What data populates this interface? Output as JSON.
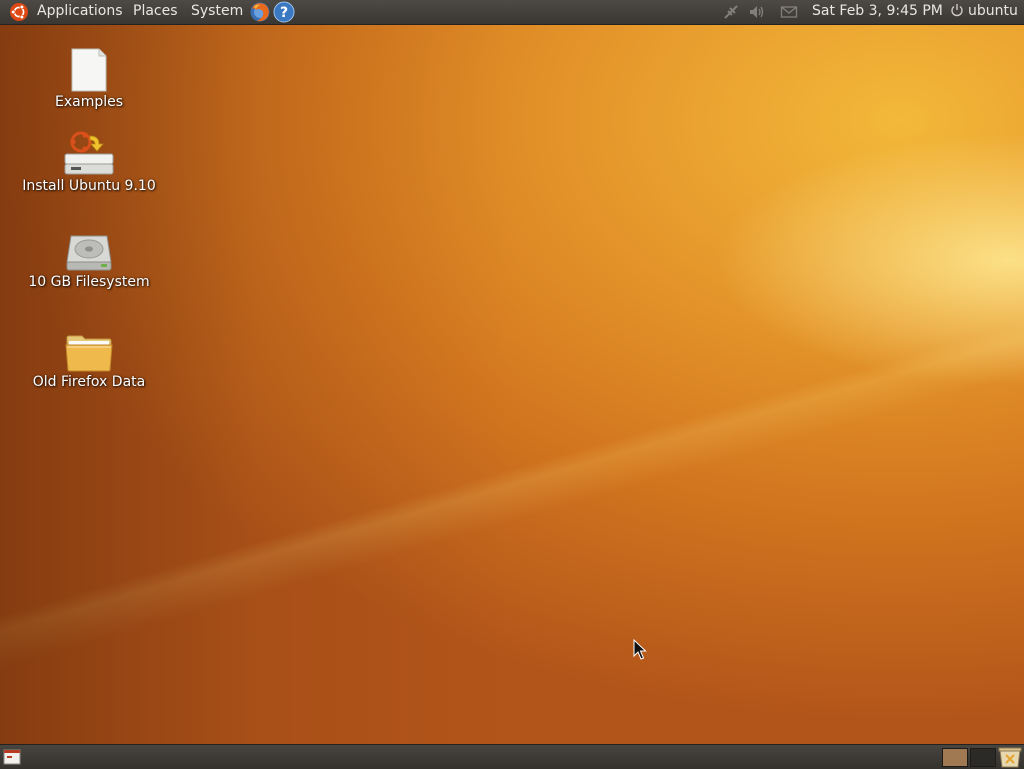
{
  "top_panel": {
    "menus": {
      "applications": "Applications",
      "places": "Places",
      "system": "System"
    },
    "launchers": [
      "firefox-icon",
      "help-icon"
    ],
    "tray_icons": [
      "network-disconnected-icon",
      "volume-muted-icon",
      "mail-icon"
    ],
    "clock": "Sat Feb  3,  9:45 PM",
    "user": "ubuntu"
  },
  "desktop": {
    "icons": [
      {
        "label": "Examples",
        "icon": "document-icon"
      },
      {
        "label": "Install Ubuntu 9.10",
        "icon": "installer-icon"
      },
      {
        "label": "10 GB Filesystem",
        "icon": "harddisk-icon"
      },
      {
        "label": "Old Firefox Data",
        "icon": "folder-icon"
      }
    ]
  },
  "bottom_panel": {
    "items": [
      "show-desktop-icon",
      "workspace-1",
      "workspace-2",
      "trash-icon"
    ]
  },
  "colors": {
    "panel": "#3f3c38",
    "panel_text": "#e9e6e1",
    "wallpaper_light": "#f3b83a",
    "wallpaper_dark": "#b2551a"
  }
}
